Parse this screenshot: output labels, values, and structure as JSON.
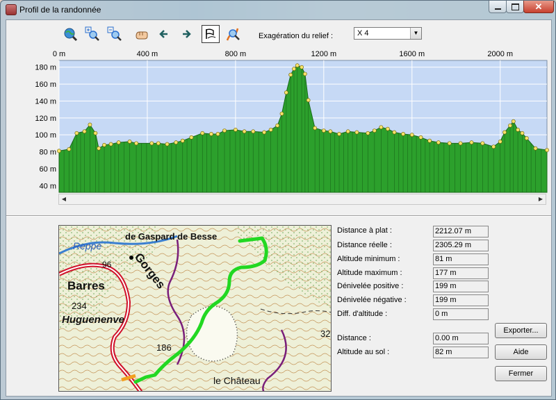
{
  "window": {
    "title": "Profil de la randonnée",
    "controls": {
      "minimize_icon": "minimize-icon",
      "maximize_icon": "maximize-icon",
      "close_icon": "close-icon",
      "close_glyph": "✕"
    }
  },
  "toolbar": {
    "buttons": [
      {
        "icon": "globe-zoom-icon"
      },
      {
        "icon": "zoom-in-icon"
      },
      {
        "icon": "zoom-out-icon"
      },
      {
        "icon": "pan-hand-icon"
      },
      {
        "icon": "arrow-left-icon"
      },
      {
        "icon": "arrow-right-icon"
      },
      {
        "icon": "flag-profile-icon",
        "active": true
      },
      {
        "icon": "route-search-icon"
      }
    ],
    "relief_label": "Exagération du relief :",
    "relief_value": "X 4"
  },
  "chart_data": {
    "type": "area",
    "xlabel": "",
    "ylabel": "",
    "x_ticks": [
      "0 m",
      "400 m",
      "800 m",
      "1200 m",
      "1600 m",
      "2000 m"
    ],
    "x_tick_values": [
      0,
      400,
      800,
      1200,
      1600,
      2000
    ],
    "y_ticks": [
      "40 m",
      "60 m",
      "80 m",
      "100 m",
      "120 m",
      "140 m",
      "160 m",
      "180 m"
    ],
    "y_tick_values": [
      40,
      60,
      80,
      100,
      120,
      140,
      160,
      180
    ],
    "xlim": [
      0,
      2212
    ],
    "ylim": [
      32,
      188
    ],
    "grid": true,
    "colors": {
      "fill": "#2ca02c",
      "plot_bg": "#c6d9f5",
      "point": "#f5e36a",
      "grid": "#ffffff"
    },
    "x": [
      0,
      45,
      80,
      115,
      140,
      165,
      180,
      205,
      235,
      270,
      320,
      350,
      420,
      450,
      490,
      530,
      560,
      600,
      650,
      690,
      720,
      750,
      800,
      840,
      880,
      930,
      960,
      990,
      1010,
      1030,
      1050,
      1065,
      1080,
      1100,
      1115,
      1130,
      1160,
      1200,
      1230,
      1270,
      1310,
      1350,
      1400,
      1430,
      1460,
      1490,
      1520,
      1560,
      1600,
      1640,
      1680,
      1720,
      1770,
      1820,
      1870,
      1920,
      1970,
      2000,
      2020,
      2045,
      2060,
      2080,
      2100,
      2120,
      2160,
      2212
    ],
    "y": [
      81,
      83,
      102,
      104,
      112,
      102,
      84,
      88,
      89,
      91,
      92,
      90,
      90,
      90,
      89,
      91,
      93,
      97,
      102,
      101,
      101,
      105,
      106,
      104,
      104,
      103,
      106,
      111,
      125,
      150,
      171,
      178,
      182,
      180,
      172,
      141,
      108,
      105,
      104,
      101,
      104,
      103,
      102,
      105,
      109,
      107,
      103,
      101,
      100,
      97,
      93,
      91,
      90,
      90,
      91,
      90,
      86,
      92,
      103,
      111,
      116,
      106,
      102,
      96,
      84,
      82
    ]
  },
  "stats": [
    {
      "label": "Distance à plat :",
      "value": "2212.07 m"
    },
    {
      "label": "Distance réelle :",
      "value": "2305.29 m"
    },
    {
      "label": "Altitude minimum :",
      "value": "81 m"
    },
    {
      "label": "Altitude maximum :",
      "value": "177 m"
    },
    {
      "label": "Dénivelée positive :",
      "value": "199 m"
    },
    {
      "label": "Dénivelée négative :",
      "value": "199 m"
    },
    {
      "label": "Diff. d'altitude :",
      "value": "0 m"
    }
  ],
  "cursor_stats": [
    {
      "label": "Distance :",
      "value": "0.00 m"
    },
    {
      "label": "Altitude au sol :",
      "value": "82 m"
    }
  ],
  "buttons": {
    "export": "Exporter...",
    "help": "Aide",
    "close": "Fermer"
  },
  "map": {
    "labels": [
      {
        "text": "de Gaspard de Besse"
      },
      {
        "text": "Reppe"
      },
      {
        "text": "96"
      },
      {
        "text": "Gorges"
      },
      {
        "text": "Barres"
      },
      {
        "text": "234"
      },
      {
        "text": "Huguenenve"
      },
      {
        "text": "186"
      },
      {
        "text": "le Château"
      },
      {
        "text": "32"
      }
    ],
    "colors": {
      "track": "#22d822",
      "road": "#d0102a",
      "river": "#3a7fd0",
      "trail": "#7a1f7a"
    }
  }
}
